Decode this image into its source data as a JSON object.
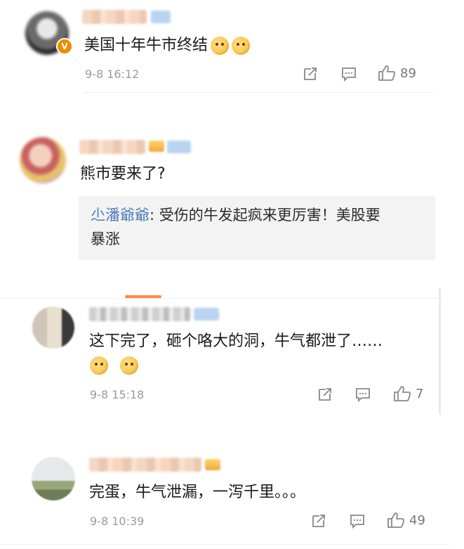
{
  "comments": [
    {
      "text": "美国十年牛市终结",
      "time": "9-8 16:12",
      "likes": "89",
      "verified_badge": "V"
    },
    {
      "text": "熊市要来了?",
      "reply": {
        "author": "尐潘爺爺",
        "separator": ": ",
        "line1": "受伤的牛发起疯来更厉害！美股要",
        "line2": "暴涨"
      }
    },
    {
      "text": "这下完了，砸个咯大的洞，牛气都泄了……",
      "time": "9-8 15:18",
      "likes": "7"
    },
    {
      "text": "完蛋，牛气泄漏，一泻千里。。。",
      "time": "9-8 10:39",
      "likes": "49"
    }
  ],
  "colors": {
    "accent": "#ff8a3d",
    "reply_author": "#4a7bbd",
    "meta": "#9a9a9a"
  },
  "icons": [
    "share-icon",
    "comment-icon",
    "like-icon"
  ]
}
